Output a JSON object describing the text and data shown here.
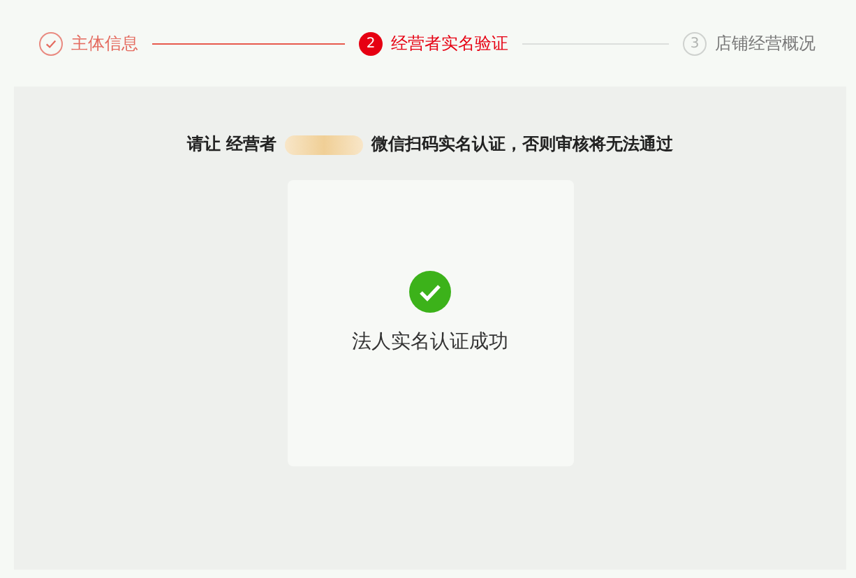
{
  "steps": [
    {
      "label": "主体信息",
      "kind": "done"
    },
    {
      "number": "2",
      "label": "经营者实名验证",
      "kind": "current"
    },
    {
      "number": "3",
      "label": "店铺经营概况",
      "kind": "pending"
    }
  ],
  "notice": {
    "prefix": "请让 经营者",
    "suffix": "微信扫码实名认证，否则审核将无法通过",
    "name_redacted": true
  },
  "result": {
    "kind": "success",
    "message": "法人实名认证成功"
  }
}
